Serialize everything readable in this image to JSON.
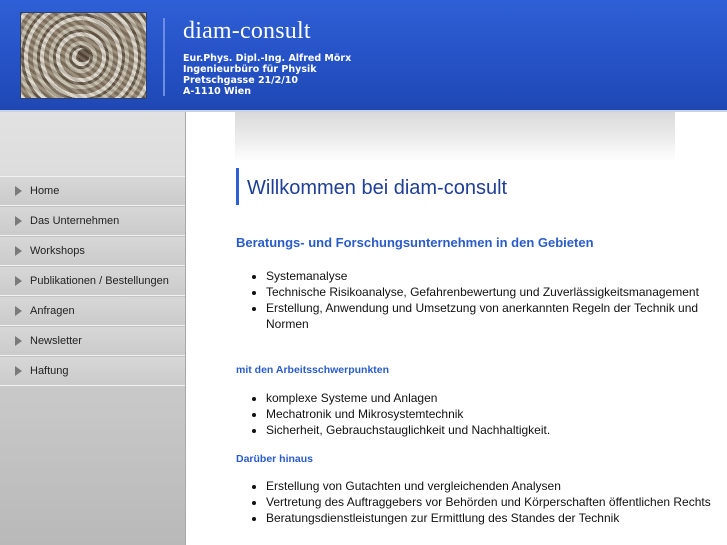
{
  "header": {
    "title": "diam-consult",
    "address_lines": [
      "Eur.Phys. Dipl.-Ing. Alfred Mörx",
      "Ingenieurbüro für Physik",
      "Pretschgasse 21/2/10",
      "A-1110 Wien"
    ],
    "brand_color": "#2451c4"
  },
  "nav": {
    "items": [
      {
        "label": "Home",
        "icon": "triangle-right-icon"
      },
      {
        "label": "Das Unternehmen",
        "icon": "triangle-right-icon"
      },
      {
        "label": "Workshops",
        "icon": "triangle-right-icon"
      },
      {
        "label": "Publikationen / Bestellungen",
        "icon": "triangle-right-icon"
      },
      {
        "label": "Anfragen",
        "icon": "triangle-right-icon"
      },
      {
        "label": "Newsletter",
        "icon": "triangle-right-icon"
      },
      {
        "label": "Haftung",
        "icon": "triangle-right-icon"
      }
    ]
  },
  "main": {
    "title": "Willkommen bei diam-consult",
    "headline": "Beratungs- und Forschungsunternehmen in den Gebieten",
    "list_a": [
      "Systemanalyse",
      "Technische Risikoanalyse, Gefahrenbewertung und Zuverlässigkeitsmanagement",
      "Erstellung, Anwendung und Umsetzung von anerkannten Regeln der Technik und Normen"
    ],
    "subheading_1": "mit den Arbeitsschwerpunkten",
    "list_b": [
      "komplexe Systeme und Anlagen",
      "Mechatronik und Mikrosystemtechnik",
      "Sicherheit, Gebrauchstauglichkeit und Nachhaltigkeit."
    ],
    "subheading_2": "Darüber hinaus",
    "list_c": [
      "Erstellung von Gutachten und vergleichenden Analysen",
      "Vertretung des Auftraggebers vor Behörden und Körperschaften öffentlichen Rechts",
      "Beratungsdienstleistungen zur Ermittlung des Standes der Technik"
    ]
  }
}
